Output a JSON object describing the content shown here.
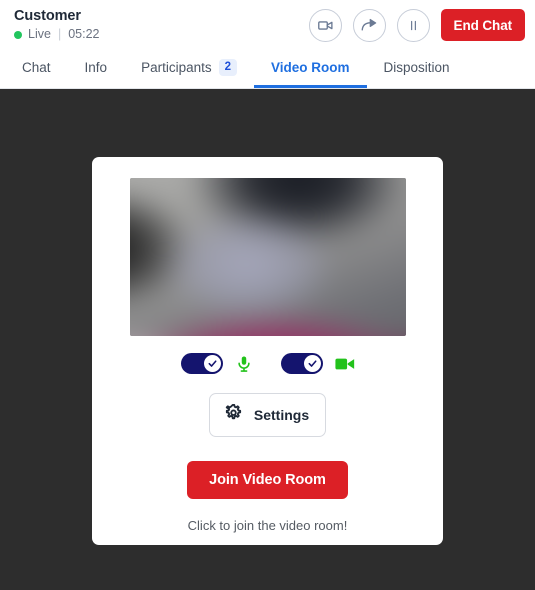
{
  "header": {
    "customer_name": "Customer",
    "status_label": "Live",
    "separator": "|",
    "timer": "05:22",
    "live_color": "#22c55e",
    "buttons": {
      "video_call": "video-camera-icon",
      "share": "share-arrow-icon",
      "pause": "pause-icon",
      "end_chat_label": "End Chat",
      "end_chat_color": "#dc2026"
    }
  },
  "tabs": {
    "accent_color": "#1f6fe0",
    "items": [
      {
        "label": "Chat",
        "badge": null,
        "active": false
      },
      {
        "label": "Info",
        "badge": null,
        "active": false
      },
      {
        "label": "Participants",
        "badge": "2",
        "active": false
      },
      {
        "label": "Video Room",
        "badge": null,
        "active": true
      },
      {
        "label": "Disposition",
        "badge": null,
        "active": false
      }
    ]
  },
  "video_room": {
    "preview_alt": "blurred-video-preview",
    "mic_toggle": {
      "state": "on",
      "icon": "microphone-icon",
      "color": "#14146e",
      "icon_color": "#22c21b"
    },
    "camera_toggle": {
      "state": "on",
      "icon": "video-camera-icon",
      "color": "#14146e",
      "icon_color": "#22c21b"
    },
    "settings_label": "Settings",
    "settings_icon": "gear-icon",
    "join_label": "Join Video Room",
    "join_color": "#dc2026",
    "hint": "Click to join the video room!"
  },
  "stage": {
    "background": "#2d2d2d"
  }
}
